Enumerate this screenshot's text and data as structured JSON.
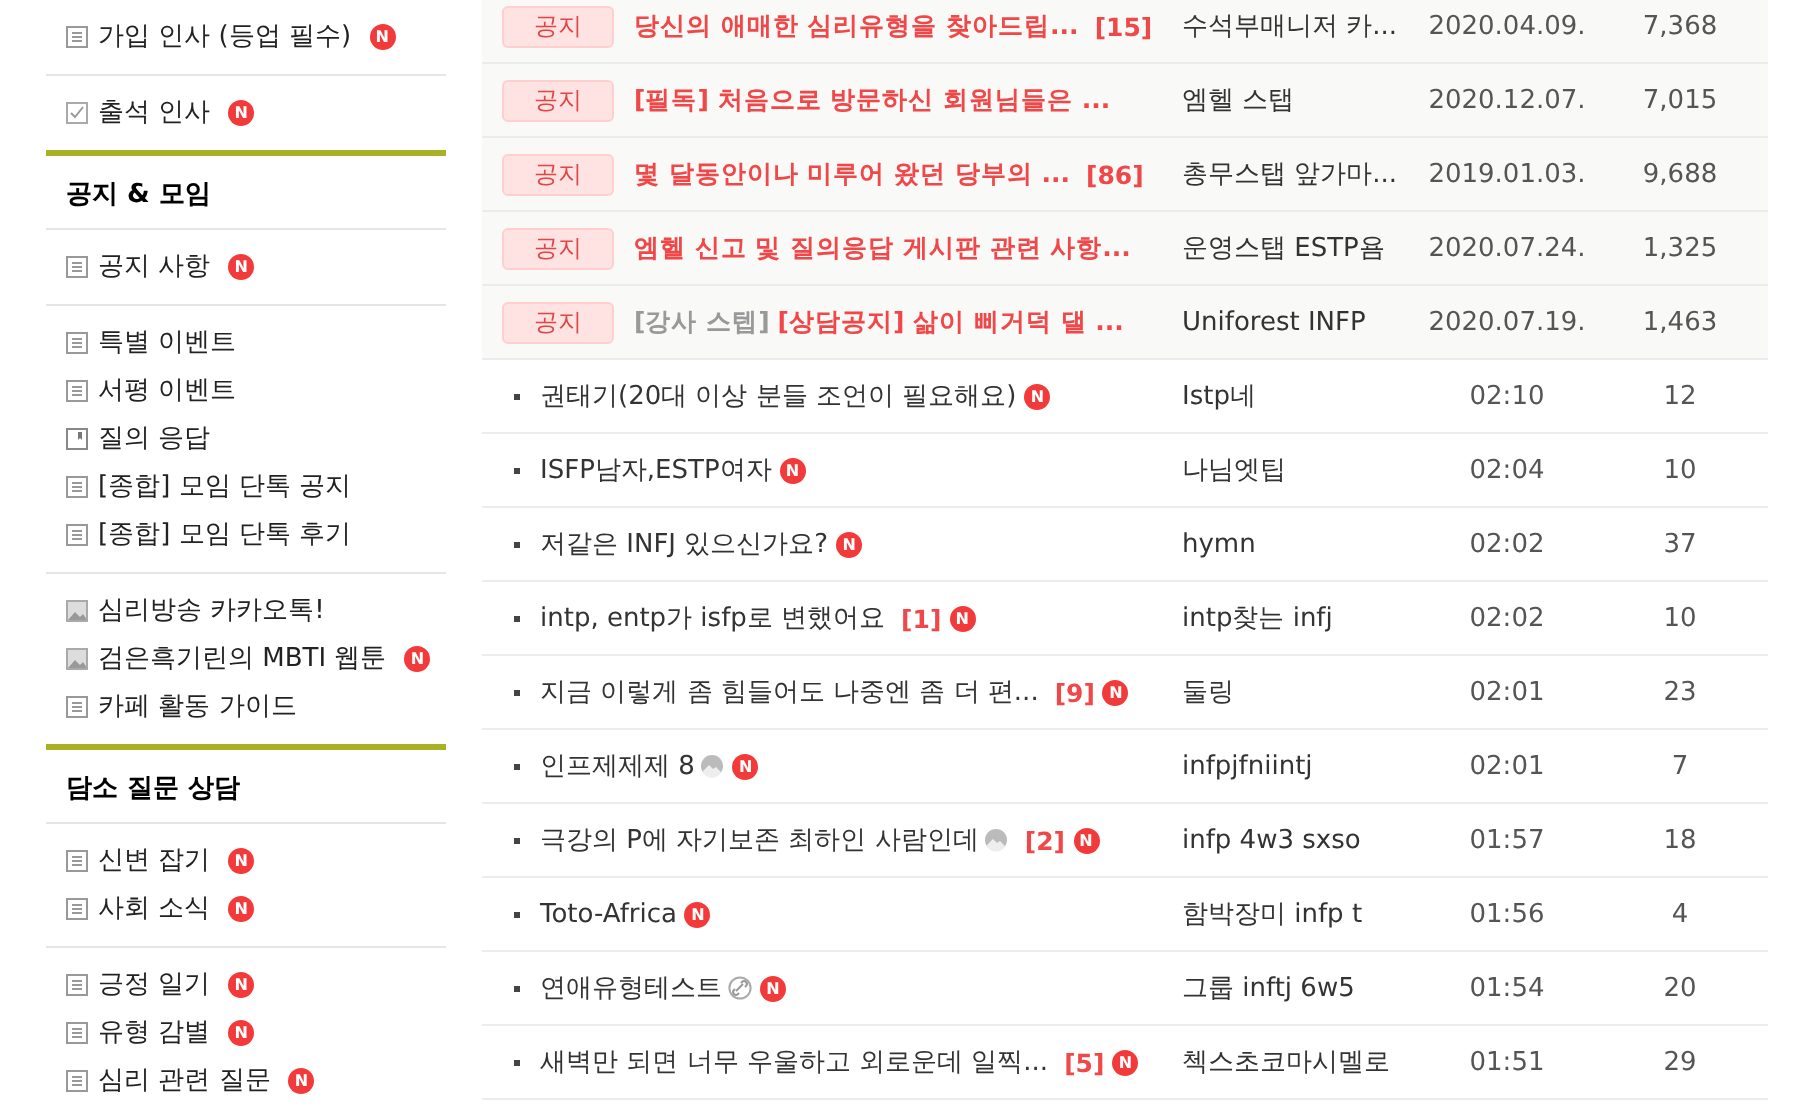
{
  "sidebar": {
    "sections": [
      {
        "groups": [
          [
            {
              "label": "가입 인사 (등업 필수)",
              "kind": "board",
              "new_label": "N"
            }
          ],
          [
            {
              "label": "출석 인사",
              "kind": "check",
              "new_label": "N"
            }
          ]
        ]
      },
      {
        "title": "공지 & 모임",
        "groups": [
          [
            {
              "label": "공지 사항",
              "kind": "board",
              "new_label": "N"
            }
          ],
          [
            {
              "label": "특별 이벤트",
              "kind": "board"
            },
            {
              "label": "서평 이벤트",
              "kind": "board"
            },
            {
              "label": "질의 응답",
              "kind": "qna"
            },
            {
              "label": "[종합] 모임 단톡 공지",
              "kind": "board"
            },
            {
              "label": "[종합] 모임 단톡 후기",
              "kind": "board"
            }
          ],
          [
            {
              "label": "심리방송 카카오톡!",
              "kind": "gallery"
            },
            {
              "label": "검은흑기린의 MBTI 웹툰",
              "kind": "gallery",
              "new_label": "N"
            },
            {
              "label": "카페 활동 가이드",
              "kind": "board"
            }
          ]
        ]
      },
      {
        "title": "담소 질문 상담",
        "groups": [
          [
            {
              "label": "신변 잡기",
              "kind": "board",
              "new_label": "N"
            },
            {
              "label": "사회 소식",
              "kind": "board",
              "new_label": "N"
            }
          ],
          [
            {
              "label": "긍정 일기",
              "kind": "board",
              "new_label": "N"
            },
            {
              "label": "유형 감별",
              "kind": "board",
              "new_label": "N"
            },
            {
              "label": "심리 관련 질문",
              "kind": "board",
              "new_label": "N"
            }
          ]
        ]
      }
    ]
  },
  "posts": [
    {
      "kind": "notice",
      "badge": "공지",
      "title": "당신의 애매한 심리유형을 찾아드립...",
      "comments": "[15]",
      "author": "수석부매니저 카...",
      "date": "2020.04.09.",
      "views": "7,368"
    },
    {
      "kind": "notice",
      "badge": "공지",
      "title": "[필독] 처음으로 방문하신 회원님들은 ...",
      "author": "엠헬 스탭",
      "date": "2020.12.07.",
      "views": "7,015"
    },
    {
      "kind": "notice",
      "badge": "공지",
      "title": "몇 달동안이나 미루어 왔던 당부의 ...",
      "comments": "[86]",
      "author": "총무스탭 앞가마...",
      "date": "2019.01.03.",
      "views": "9,688"
    },
    {
      "kind": "notice",
      "badge": "공지",
      "title": "엠헬 신고 및 질의응답 게시판 관련 사항...",
      "author": "운영스탭 ESTP욤",
      "date": "2020.07.24.",
      "views": "1,325"
    },
    {
      "kind": "notice",
      "badge": "공지",
      "prefix": "[강사 스텝]",
      "title": "[상담공지] 삶이 삐거덕 댈 ...",
      "author": "Uniforest INFP",
      "date": "2020.07.19.",
      "views": "1,463"
    },
    {
      "kind": "post",
      "title": "권태기(20대 이상 분들 조언이 필요해요)",
      "new_label": "N",
      "author": "Istp네",
      "date": "02:10",
      "views": "12"
    },
    {
      "kind": "post",
      "title": "ISFP남자,ESTP여자",
      "new_label": "N",
      "author": "나님엣팁",
      "date": "02:04",
      "views": "10"
    },
    {
      "kind": "post",
      "title": "저같은 INFJ 있으신가요?",
      "new_label": "N",
      "author": "hymn",
      "date": "02:02",
      "views": "37"
    },
    {
      "kind": "post",
      "title": "intp, entp가 isfp로 변했어요",
      "comments": "[1]",
      "new_label": "N",
      "author": "intp찾는 infj",
      "date": "02:02",
      "views": "10"
    },
    {
      "kind": "post",
      "title": "지금 이렇게 좀 힘들어도 나중엔 좀 더 편...",
      "comments": "[9]",
      "new_label": "N",
      "author": "둘링",
      "date": "02:01",
      "views": "23"
    },
    {
      "kind": "post",
      "title": "인프제제제 8",
      "attachment": {
        "kind": "image"
      },
      "new_label": "N",
      "author": "infpjfniintj",
      "date": "02:01",
      "views": "7"
    },
    {
      "kind": "post",
      "title": "극강의 P에 자기보존 최하인 사람인데",
      "attachment": {
        "kind": "image"
      },
      "comments": "[2]",
      "new_label": "N",
      "author": "infp 4w3 sxso",
      "date": "01:57",
      "views": "18"
    },
    {
      "kind": "post",
      "title": "Toto-Africa",
      "new_label": "N",
      "author": "함박장미 infp t",
      "date": "01:56",
      "views": "4"
    },
    {
      "kind": "post",
      "title": "연애유형테스트",
      "attachment": {
        "kind": "link"
      },
      "new_label": "N",
      "author": "그룹 inftj 6w5",
      "date": "01:54",
      "views": "20"
    },
    {
      "kind": "post",
      "title": "새벽만 되면 너무 우울하고 외로운데 일찍...",
      "comments": "[5]",
      "new_label": "N",
      "author": "첵스초코마시멜로",
      "date": "01:51",
      "views": "29"
    }
  ]
}
